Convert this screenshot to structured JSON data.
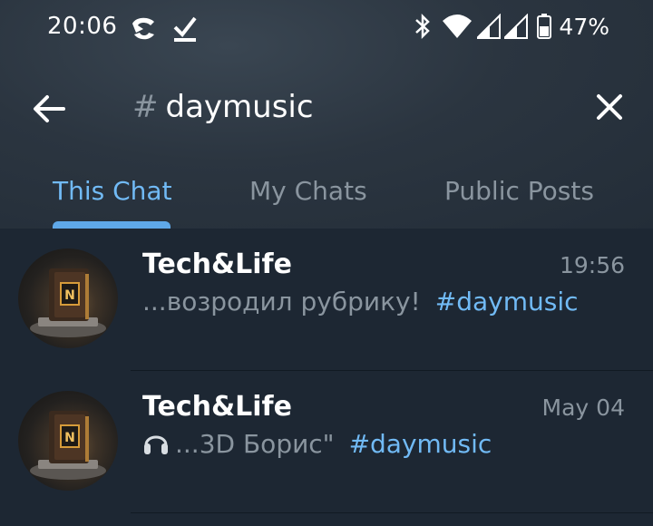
{
  "status_bar": {
    "time": "20:06",
    "left_icons": [
      "app-notification-icon",
      "check-download-icon"
    ],
    "right_icons": [
      "bluetooth-icon",
      "wifi-icon",
      "signal-icon",
      "signal-icon",
      "battery-icon"
    ],
    "battery": "47%"
  },
  "search": {
    "hash_prefix": "#",
    "query": "daymusic"
  },
  "tabs": [
    {
      "label": "This Chat",
      "active": true
    },
    {
      "label": "My Chats",
      "active": false
    },
    {
      "label": "Public Posts",
      "active": false
    }
  ],
  "results": [
    {
      "title": "Tech&Life",
      "time": "19:56",
      "snippet": "...возродил рубрику!",
      "tag": "#daymusic",
      "icon": ""
    },
    {
      "title": "Tech&Life",
      "time": "May 04",
      "snippet": "...3D Борис\"",
      "tag": "#daymusic",
      "icon": "headphones-icon"
    }
  ],
  "colors": {
    "accent": "#71baf5",
    "background": "#1d2733",
    "secondary_text": "#8a959f"
  }
}
